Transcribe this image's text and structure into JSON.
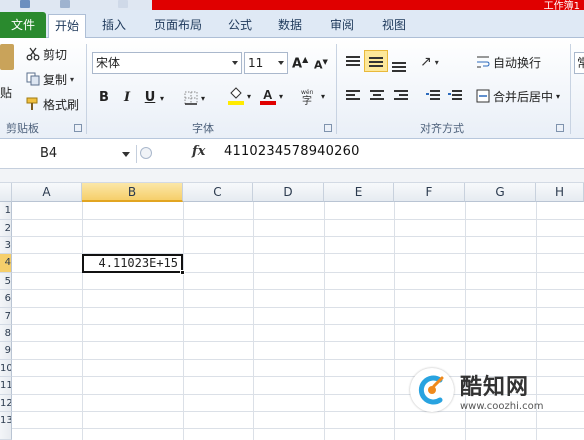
{
  "title_fragment": "工作簿1",
  "tabs": [
    {
      "label": "文件",
      "active": false
    },
    {
      "label": "开始",
      "active": true
    },
    {
      "label": "插入",
      "active": false
    },
    {
      "label": "页面布局",
      "active": false
    },
    {
      "label": "公式",
      "active": false
    },
    {
      "label": "数据",
      "active": false
    },
    {
      "label": "审阅",
      "active": false
    },
    {
      "label": "视图",
      "active": false
    }
  ],
  "clipboard": {
    "paste_label": "贴",
    "cut_label": "剪切",
    "copy_label": "复制",
    "format_painter_label": "格式刷",
    "group_label": "剪贴板"
  },
  "font": {
    "family": "宋体",
    "size": "11",
    "bold": "B",
    "italic": "I",
    "underline": "U",
    "group_label": "字体"
  },
  "alignment": {
    "wrap_text_label": "自动换行",
    "merge_center_label": "合并后居中",
    "group_label": "对齐方式"
  },
  "number": {
    "format_partial": "常"
  },
  "formula_bar": {
    "name_box": "B4",
    "fx": "fx",
    "value": "4110234578940260"
  },
  "columns": [
    "A",
    "B",
    "C",
    "D",
    "E",
    "F",
    "G",
    "H"
  ],
  "selected_column": "B",
  "selected_row": "4",
  "rows": [
    "1",
    "2",
    "3",
    "4",
    "5",
    "6",
    "7",
    "8",
    "9",
    "10",
    "11",
    "12",
    "13"
  ],
  "active_cell": {
    "ref": "B4",
    "display": "4.11023E+15"
  },
  "watermark": {
    "title": "酷知网",
    "url": "www.coozhi.com"
  },
  "colors": {
    "file_tab": "#2a8a2e",
    "title_red": "#e00000",
    "selected_header": "#f6cf6b",
    "font_color_bar": "#e00000",
    "fill_color_bar": "#ffeb00"
  }
}
